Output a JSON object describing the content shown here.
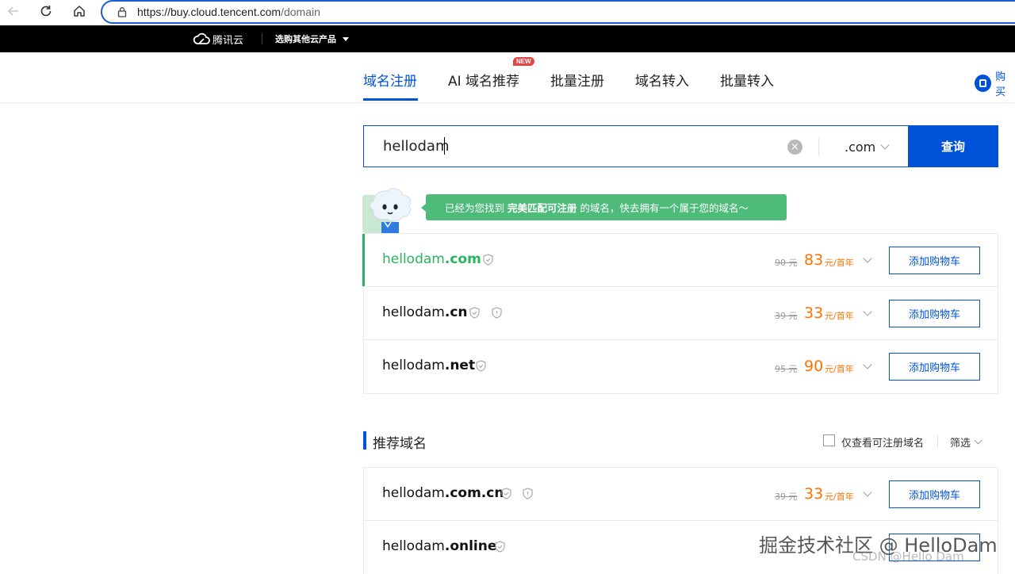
{
  "browser": {
    "url_host": "https://buy.cloud.tencent.com",
    "url_path": "/domain"
  },
  "topbar": {
    "brand": "腾讯云",
    "products_menu": "选购其他云产品"
  },
  "tabs": [
    {
      "label": "域名注册",
      "active": true
    },
    {
      "label": "AI 域名推荐",
      "badge": "NEW"
    },
    {
      "label": "批量注册"
    },
    {
      "label": "域名转入"
    },
    {
      "label": "批量转入"
    }
  ],
  "buy_link": "购买",
  "search": {
    "value": "hellodam",
    "tld": ".com",
    "button": "查询"
  },
  "bubble": {
    "prefix": "已经为您找到",
    "highlight": "完美匹配可注册",
    "suffix": "的域名，快去拥有一个属于您的域名～"
  },
  "results": [
    {
      "name": "hellodam",
      "tld": ".com",
      "old_price": "90 元",
      "price": "83",
      "unit": "元/首年",
      "button": "添加购物车",
      "icons": 1
    },
    {
      "name": "hellodam",
      "tld": ".cn",
      "old_price": "39 元",
      "price": "33",
      "unit": "元/首年",
      "button": "添加购物车",
      "icons": 2
    },
    {
      "name": "hellodam",
      "tld": ".net",
      "old_price": "95 元",
      "price": "90",
      "unit": "元/首年",
      "button": "添加购物车",
      "icons": 1
    }
  ],
  "recommended": {
    "title": "推荐域名",
    "checkbox_label": "仅查看可注册域名",
    "filter": "筛选",
    "items": [
      {
        "name": "hellodam",
        "tld": ".com.cn",
        "old_price": "39 元",
        "price": "33",
        "unit": "元/首年",
        "button": "添加购物车",
        "icons": 2
      },
      {
        "name": "hellodam",
        "tld": ".online",
        "old_price": "",
        "price": "",
        "unit": "",
        "button": "",
        "icons": 1
      }
    ]
  },
  "watermark": {
    "main": "掘金技术社区 @ HelloDam",
    "sub": "CSDN @Hello Dam"
  },
  "colors": {
    "primary": "#0052d9",
    "success": "#29b25f",
    "price": "#ff7200"
  }
}
